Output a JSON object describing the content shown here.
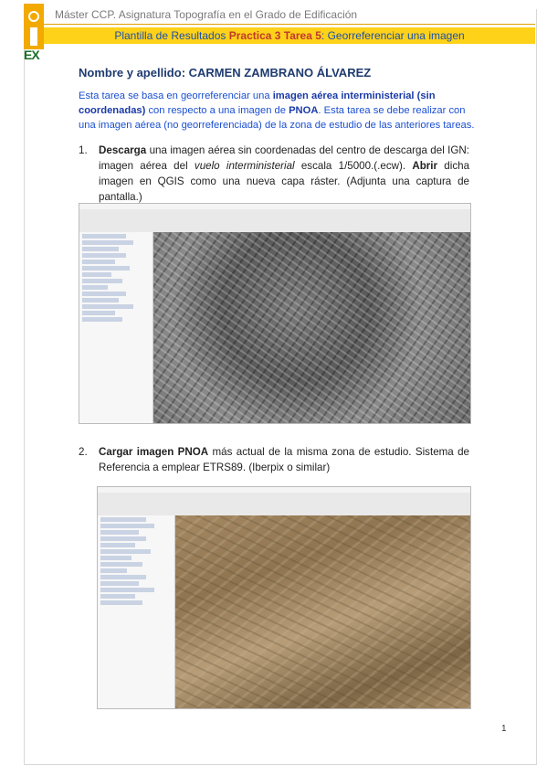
{
  "header": {
    "course": "Máster CCP. Asignatura Topografía en el Grado de Edificación",
    "banner_prefix": "Plantilla de Resultados ",
    "banner_bold": "Practica 3 Tarea 5",
    "banner_suffix": ": Georreferenciar una imagen",
    "logo_text": "EX"
  },
  "student": {
    "label": "Nombre y apellido: ",
    "name": "CARMEN ZAMBRANO ÁLVAREZ"
  },
  "intro": {
    "p1": "Esta tarea se basa en georreferenciar una ",
    "b1": "imagen aérea interministerial (sin coordenadas)",
    "p2": " con respecto a una imagen de ",
    "b2": "PNOA",
    "p3": ". Esta tarea se debe realizar con una imagen aérea (no georreferenciada) de la zona de estudio de las anteriores tareas."
  },
  "tasks": [
    {
      "number": "1.",
      "b1": "Descarga",
      "t1": " una imagen aérea sin coordenadas del centro de descarga del IGN: imagen aérea del ",
      "i1": "vuelo interministerial",
      "t2": " escala 1/5000.(.ecw). ",
      "b2": "Abrir",
      "t3": " dicha imagen en QGIS como una nueva capa ráster. (Adjunta una captura de pantalla.)"
    },
    {
      "number": "2.",
      "b1": "Cargar imagen PNOA",
      "t1": " más actual de la misma zona de estudio. Sistema de Referencia a emplear ETRS89. (Iberpix o similar)"
    }
  ],
  "page_number": "1"
}
